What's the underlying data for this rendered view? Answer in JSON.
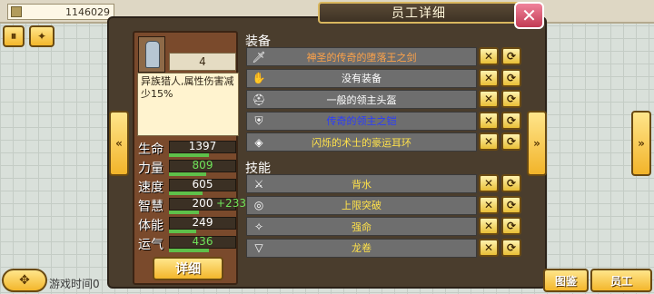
{
  "top": {
    "money": "1146029"
  },
  "buttons": {
    "pause": "⏸",
    "skills": "✦",
    "move": "✥",
    "atlas": "图鉴",
    "staff": "员工",
    "detail": "详细"
  },
  "footer": {
    "game_time": "游戏时间0"
  },
  "dialog": {
    "title": "员工详细",
    "close": "✕"
  },
  "hero": {
    "level": "4",
    "description": "异族猎人,属性伤害减少15%",
    "stats": [
      {
        "label": "生命",
        "value": "1397",
        "bar": 0.6,
        "green": false,
        "plus": ""
      },
      {
        "label": "力量",
        "value": "809",
        "bar": 0.55,
        "green": true,
        "plus": ""
      },
      {
        "label": "速度",
        "value": "605",
        "bar": 0.5,
        "green": false,
        "plus": ""
      },
      {
        "label": "智慧",
        "value": "200",
        "bar": 0.45,
        "green": false,
        "plus": "+233"
      },
      {
        "label": "体能",
        "value": "249",
        "bar": 0.4,
        "green": false,
        "plus": ""
      },
      {
        "label": "运气",
        "value": "436",
        "bar": 0.6,
        "green": true,
        "plus": ""
      }
    ]
  },
  "equipment": {
    "title": "装备",
    "items": [
      {
        "name": "神圣的传奇的堕落王之剑",
        "color": "#ffa348",
        "icon": "sword-icon",
        "glyph": "🗡"
      },
      {
        "name": "没有装备",
        "color": "#ffffff",
        "icon": "glove-icon",
        "glyph": "✋"
      },
      {
        "name": "一般的领主头盔",
        "color": "#ffffff",
        "icon": "helmet-icon",
        "glyph": "⛑"
      },
      {
        "name": "传奇的领主之铠",
        "color": "#2a3cff",
        "icon": "armor-icon",
        "glyph": "⛨"
      },
      {
        "name": "闪烁的术士的豪运耳环",
        "color": "#ffe14a",
        "icon": "earring-icon",
        "glyph": "◈"
      }
    ]
  },
  "skills": {
    "title": "技能",
    "items": [
      {
        "name": "背水",
        "color": "#ffe14a",
        "icon": "dagger-icon",
        "glyph": "⚔"
      },
      {
        "name": "上限突破",
        "color": "#ffe14a",
        "icon": "ring-icon",
        "glyph": "◎"
      },
      {
        "name": "强命",
        "color": "#ffe14a",
        "icon": "feather-icon",
        "glyph": "✧"
      },
      {
        "name": "龙卷",
        "color": "#ffe14a",
        "icon": "tornado-icon",
        "glyph": "▽"
      }
    ]
  },
  "nav": {
    "prev_outer": "«",
    "next_outer": "»",
    "prev_inner": "«",
    "next_inner": "»"
  },
  "colors": {
    "panel": "#4a3d2d",
    "row": "#6e6e6e",
    "gold": "#f3b72c"
  }
}
